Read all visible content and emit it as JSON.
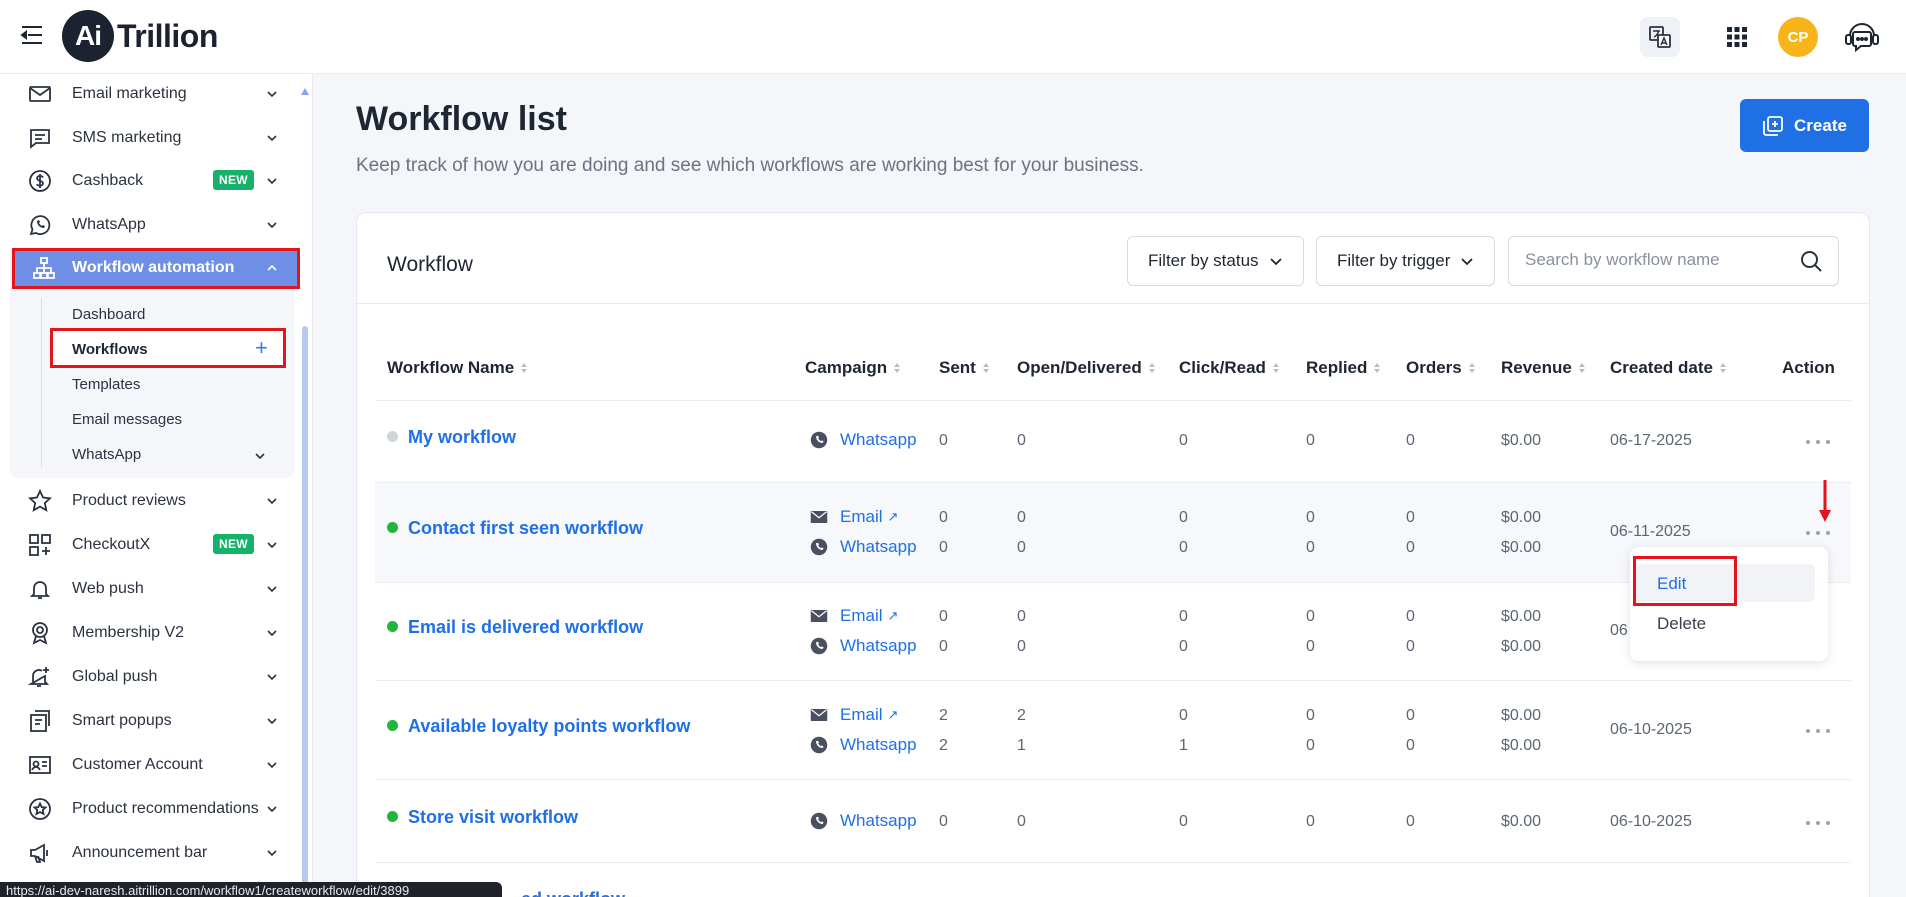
{
  "app": {
    "logo_mark": "Ai",
    "logo_text": "Trillion"
  },
  "topbar": {
    "avatar_initials": "CP",
    "icons": [
      "translate-icon",
      "apps-grid-icon",
      "support-chat-icon"
    ]
  },
  "sidebar": {
    "items": [
      {
        "label": "Email marketing",
        "icon": "mail-icon"
      },
      {
        "label": "SMS marketing",
        "icon": "message-icon"
      },
      {
        "label": "Cashback",
        "icon": "dollar-circle-icon",
        "badge": "NEW"
      },
      {
        "label": "WhatsApp",
        "icon": "whatsapp-icon"
      },
      {
        "label": "Workflow automation",
        "icon": "workflow-icon",
        "active": true
      },
      {
        "label": "Product reviews",
        "icon": "star-icon"
      },
      {
        "label": "CheckoutX",
        "icon": "grid-plus-icon",
        "badge": "NEW"
      },
      {
        "label": "Web push",
        "icon": "bell-icon"
      },
      {
        "label": "Membership V2",
        "icon": "badge-icon"
      },
      {
        "label": "Global push",
        "icon": "bell-plus-icon"
      },
      {
        "label": "Smart popups",
        "icon": "popup-icon"
      },
      {
        "label": "Customer Account",
        "icon": "id-card-icon"
      },
      {
        "label": "Product recommendations",
        "icon": "star-circle-icon"
      },
      {
        "label": "Announcement bar",
        "icon": "megaphone-icon"
      }
    ],
    "sub_items": [
      {
        "label": "Dashboard"
      },
      {
        "label": "Workflows",
        "active": true
      },
      {
        "label": "Templates"
      },
      {
        "label": "Email messages"
      },
      {
        "label": "WhatsApp"
      }
    ]
  },
  "main": {
    "title": "Workflow list",
    "subtitle": "Keep track of how you are doing and see which workflows are working best for your business.",
    "create_label": "Create"
  },
  "card": {
    "title": "Workflow",
    "filter_status": "Filter by status",
    "filter_trigger": "Filter by trigger",
    "search_placeholder": "Search by workflow name"
  },
  "table": {
    "headers": [
      "Workflow Name",
      "Campaign",
      "Sent",
      "Open/Delivered",
      "Click/Read",
      "Replied",
      "Orders",
      "Revenue",
      "Created date",
      "Action"
    ],
    "rows": [
      {
        "name": "My workflow",
        "status": "inactive",
        "created": "06-17-2025",
        "campaigns": [
          {
            "channel": "Whatsapp",
            "sent": "0",
            "open": "0",
            "click": "0",
            "replied": "0",
            "orders": "0",
            "revenue": "$0.00"
          }
        ]
      },
      {
        "name": "Contact first seen workflow",
        "status": "active",
        "created": "06-11-2025",
        "campaigns": [
          {
            "channel": "Email",
            "sent": "0",
            "open": "0",
            "click": "0",
            "replied": "0",
            "orders": "0",
            "revenue": "$0.00"
          },
          {
            "channel": "Whatsapp",
            "sent": "0",
            "open": "0",
            "click": "0",
            "replied": "0",
            "orders": "0",
            "revenue": "$0.00"
          }
        ]
      },
      {
        "name": "Email is delivered workflow",
        "status": "active",
        "created": "06",
        "campaigns": [
          {
            "channel": "Email",
            "sent": "0",
            "open": "0",
            "click": "0",
            "replied": "0",
            "orders": "0",
            "revenue": "$0.00"
          },
          {
            "channel": "Whatsapp",
            "sent": "0",
            "open": "0",
            "click": "0",
            "replied": "0",
            "orders": "0",
            "revenue": "$0.00"
          }
        ]
      },
      {
        "name": "Available loyalty points workflow",
        "status": "active",
        "created": "06-10-2025",
        "campaigns": [
          {
            "channel": "Email",
            "sent": "2",
            "open": "2",
            "click": "0",
            "replied": "0",
            "orders": "0",
            "revenue": "$0.00"
          },
          {
            "channel": "Whatsapp",
            "sent": "2",
            "open": "1",
            "click": "1",
            "replied": "0",
            "orders": "0",
            "revenue": "$0.00"
          }
        ]
      },
      {
        "name": "Store visit workflow",
        "status": "active",
        "created": "06-10-2025",
        "campaigns": [
          {
            "channel": "Whatsapp",
            "sent": "0",
            "open": "0",
            "click": "0",
            "replied": "0",
            "orders": "0",
            "revenue": "$0.00"
          }
        ]
      }
    ],
    "partial_row_name": "...ed workflow"
  },
  "action_menu": {
    "edit": "Edit",
    "delete": "Delete"
  },
  "status_bar": {
    "url": "https://ai-dev-naresh.aitrillion.com/workflow1/createworkflow/edit/3899"
  },
  "colors": {
    "accent": "#1f6fe5",
    "active_nav": "#6f8fe6",
    "badge_new": "#17b26a",
    "highlight": "#e3141b",
    "avatar": "#f7b51b"
  }
}
